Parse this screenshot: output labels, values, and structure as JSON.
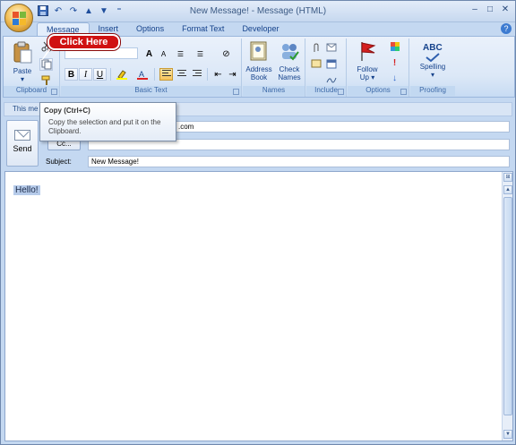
{
  "window": {
    "title": "New Message! - Message (HTML)",
    "controls": {
      "minimize": "–",
      "maximize": "□",
      "close": "✕"
    }
  },
  "ribbon_tabs": [
    "Message",
    "Insert",
    "Options",
    "Format Text",
    "Developer"
  ],
  "active_tab": "Message",
  "clipboard": {
    "paste_label": "Paste",
    "group_label": "Clipboard"
  },
  "basic_text": {
    "group_label": "Basic Text",
    "bold": "B",
    "italic": "I",
    "underline": "U",
    "grow_font": "A",
    "shrink_font": "A"
  },
  "names": {
    "address_book_line1": "Address",
    "address_book_line2": "Book",
    "check_names_line1": "Check",
    "check_names_line2": "Names",
    "group_label": "Names"
  },
  "include": {
    "group_label": "Include"
  },
  "options": {
    "follow_up_line1": "Follow",
    "follow_up_line2": "Up ▾",
    "group_label": "Options"
  },
  "proofing": {
    "abc": "ABC",
    "spelling": "Spelling",
    "group_label": "Proofing"
  },
  "callout": {
    "text": "Click Here"
  },
  "tooltip": {
    "title": "Copy (Ctrl+C)",
    "description": "Copy the selection and put it on the Clipboard."
  },
  "infobar": {
    "text": "This me"
  },
  "header": {
    "send_label": "Send",
    "to_value_visible": ".com",
    "cc_button": "Cc...",
    "cc_value": "",
    "subject_label": "Subject:",
    "subject_value": "New Message!"
  },
  "body": {
    "text": "Hello!"
  },
  "colors": {
    "accent": "#15428b",
    "callout_red": "#d01212",
    "ribbon_bg": "#dce8f7"
  }
}
